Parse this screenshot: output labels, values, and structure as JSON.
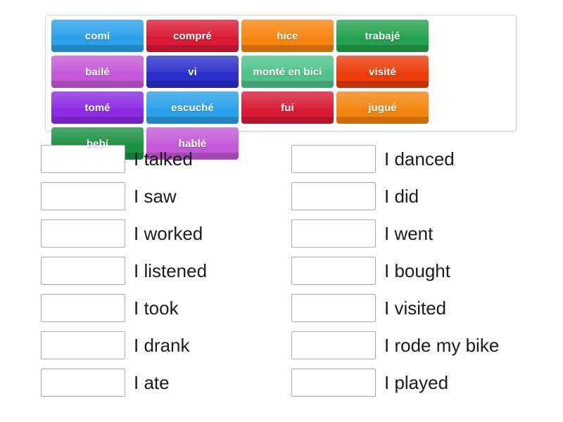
{
  "activity": {
    "type": "match-up",
    "language_pair": "Spanish to English",
    "colors": {
      "tile_blue_light": "#29a0e8",
      "tile_red_crimson": "#d81a35",
      "tile_orange": "#f58410",
      "tile_green_dark": "#23a14d",
      "tile_orchid": "#c558d8",
      "tile_blue_dark": "#2b30c9",
      "tile_mint": "#4ec289",
      "tile_orange_red": "#ec3c0b",
      "tile_violet": "#8a2be2",
      "tile_green_forest": "#19913f",
      "slot_border": "#adadad",
      "panel_border": "#d6d6d6",
      "text_on_tile": "#ffffff",
      "answer_text": "#1b1b1b"
    }
  },
  "word_bank": {
    "tiles": [
      {
        "label": "comí",
        "color": "#29a0e8"
      },
      {
        "label": "compré",
        "color": "#d81a35"
      },
      {
        "label": "hice",
        "color": "#f58410"
      },
      {
        "label": "trabajé",
        "color": "#23a14d"
      },
      {
        "label": "bailé",
        "color": "#c558d8"
      },
      {
        "label": "vi",
        "color": "#2b30c9"
      },
      {
        "label": "monté en bici",
        "color": "#4ec289"
      },
      {
        "label": "visité",
        "color": "#ec3c0b"
      },
      {
        "label": "tomé",
        "color": "#8a2be2"
      },
      {
        "label": "escuché",
        "color": "#29a0e8"
      },
      {
        "label": "fui",
        "color": "#d81a35"
      },
      {
        "label": "jugué",
        "color": "#f58410"
      },
      {
        "label": "bebí",
        "color": "#19913f"
      },
      {
        "label": "hablé",
        "color": "#c558d8"
      }
    ]
  },
  "answers": {
    "left_column": [
      {
        "slot_value": "",
        "prompt": "I talked"
      },
      {
        "slot_value": "",
        "prompt": "I saw"
      },
      {
        "slot_value": "",
        "prompt": "I worked"
      },
      {
        "slot_value": "",
        "prompt": "I listened"
      },
      {
        "slot_value": "",
        "prompt": "I took"
      },
      {
        "slot_value": "",
        "prompt": "I drank"
      },
      {
        "slot_value": "",
        "prompt": "I ate"
      }
    ],
    "right_column": [
      {
        "slot_value": "",
        "prompt": "I danced"
      },
      {
        "slot_value": "",
        "prompt": "I did"
      },
      {
        "slot_value": "",
        "prompt": "I went"
      },
      {
        "slot_value": "",
        "prompt": "I bought"
      },
      {
        "slot_value": "",
        "prompt": "I visited"
      },
      {
        "slot_value": "",
        "prompt": "I rode my bike"
      },
      {
        "slot_value": "",
        "prompt": "I played"
      }
    ]
  }
}
